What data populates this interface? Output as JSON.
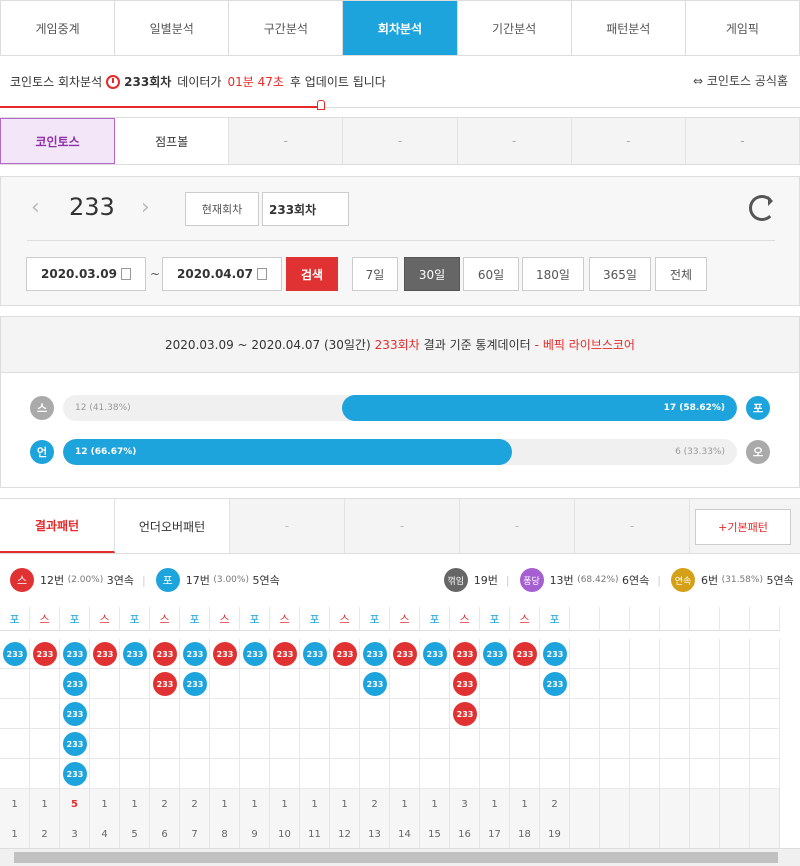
{
  "tabs": [
    "게임중계",
    "일별분석",
    "구간분석",
    "회차분석",
    "기간분석",
    "패턴분석",
    "게임픽"
  ],
  "active_tab": 3,
  "info": {
    "prefix": "코인토스 회차분석",
    "round": "233회차",
    "mid": "데이터가",
    "timer": "01분 47초",
    "suffix": "후 업데이트 됩니다",
    "official": "코인토스 공식홈"
  },
  "game_tabs": [
    "코인토스",
    "점프볼",
    "-",
    "-",
    "-",
    "-",
    "-"
  ],
  "controls": {
    "round_number": "233",
    "current_label": "현재회차",
    "current_value": "233회차",
    "date_from": "2020.03.09",
    "tilde": "~",
    "date_to": "2020.04.07",
    "search": "검색",
    "periods": [
      "7일",
      "30일",
      "60일",
      "180일",
      "365일",
      "전체"
    ],
    "active_period": 1
  },
  "stats": {
    "headline_prefix": "2020.03.09 ~ 2020.04.07 (30일간)",
    "headline_round": "233회차",
    "headline_mid": "결과 기준 통계데이터",
    "headline_suffix": "- 베픽 라이브스코어",
    "row1": {
      "left_icon": "스",
      "left_text": "12 (41.38%)",
      "right_text": "17 (58.62%)",
      "right_icon": "포",
      "fill_fraction": 0.5862
    },
    "row2": {
      "left_icon": "언",
      "left_text": "12 (66.67%)",
      "right_text": "6 (33.33%)",
      "right_icon": "오",
      "fill_fraction": 0.6667
    }
  },
  "pattern_tabs": [
    "결과패턴",
    "언더오버패턴",
    "-",
    "-",
    "-",
    "-"
  ],
  "basic_pattern": "+기본패턴",
  "summary": {
    "s_icon": "스",
    "s_text": "12번",
    "s_pct": "(2.00%)",
    "s_streak": "3연속",
    "p_icon": "포",
    "p_text": "17번",
    "p_pct": "(3.00%)",
    "p_streak": "5연속",
    "k_icon": "꺾임",
    "k_text": "19번",
    "d_icon": "퐁당",
    "d_text": "13번",
    "d_pct": "(68.42%)",
    "d_streak": "6연속",
    "y_icon": "연속",
    "y_text": "6번",
    "y_pct": "(31.58%)",
    "y_streak": "5연속"
  },
  "colors": {
    "blue": "#1ea4dc",
    "red": "#e03232",
    "purple": "#a55fd0",
    "gold": "#d4a017",
    "gray": "#666666"
  },
  "columns": [
    {
      "head": "포",
      "count": "1",
      "index": "1",
      "type": "p"
    },
    {
      "head": "스",
      "count": "1",
      "index": "2",
      "type": "s"
    },
    {
      "head": "포",
      "count": "5",
      "index": "3",
      "type": "p"
    },
    {
      "head": "스",
      "count": "1",
      "index": "4",
      "type": "s"
    },
    {
      "head": "포",
      "count": "1",
      "index": "5",
      "type": "p"
    },
    {
      "head": "스",
      "count": "2",
      "index": "6",
      "type": "s"
    },
    {
      "head": "포",
      "count": "2",
      "index": "7",
      "type": "p"
    },
    {
      "head": "스",
      "count": "1",
      "index": "8",
      "type": "s"
    },
    {
      "head": "포",
      "count": "1",
      "index": "9",
      "type": "p"
    },
    {
      "head": "스",
      "count": "1",
      "index": "10",
      "type": "s"
    },
    {
      "head": "포",
      "count": "1",
      "index": "11",
      "type": "p"
    },
    {
      "head": "스",
      "count": "1",
      "index": "12",
      "type": "s"
    },
    {
      "head": "포",
      "count": "2",
      "index": "13",
      "type": "p"
    },
    {
      "head": "스",
      "count": "1",
      "index": "14",
      "type": "s"
    },
    {
      "head": "포",
      "count": "1",
      "index": "15",
      "type": "p"
    },
    {
      "head": "스",
      "count": "3",
      "index": "16",
      "type": "s"
    },
    {
      "head": "포",
      "count": "1",
      "index": "17",
      "type": "p"
    },
    {
      "head": "스",
      "count": "1",
      "index": "18",
      "type": "s"
    },
    {
      "head": "포",
      "count": "2",
      "index": "19",
      "type": "p"
    }
  ],
  "dot_label": "233"
}
